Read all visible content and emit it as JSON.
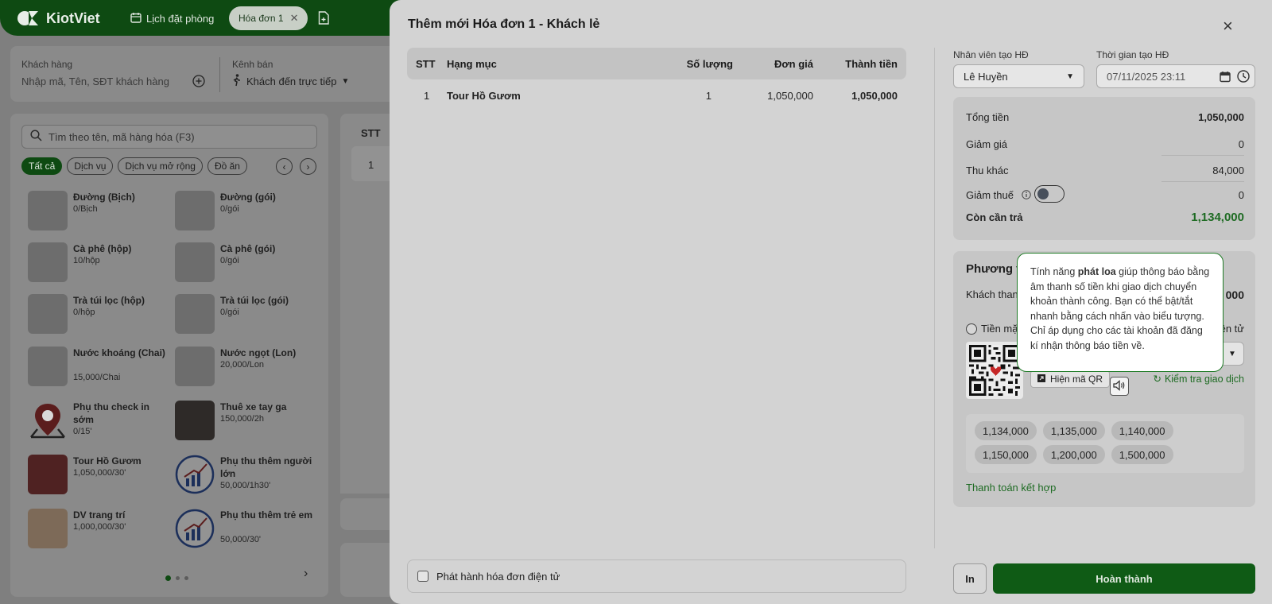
{
  "app": {
    "logo": "KiotViet",
    "nav_booking": "Lịch đặt phòng",
    "tab_active": "Hóa đơn 1"
  },
  "customer_bar": {
    "customer_label": "Khách hàng",
    "customer_placeholder": "Nhập mã, Tên, SĐT khách hàng",
    "channel_label": "Kênh bán",
    "channel_value": "Khách đến trực tiếp"
  },
  "products": {
    "search_placeholder": "Tìm theo tên, mã hàng hóa (F3)",
    "filters": [
      "Tất cả",
      "Dịch vụ",
      "Dịch vụ mở rộng",
      "Đồ ăn"
    ],
    "items": [
      {
        "name": "Đường (Bịch)",
        "price": "0/Bịch"
      },
      {
        "name": "Đường (gói)",
        "price": "0/gói"
      },
      {
        "name": "Cà phê (hộp)",
        "price": "10/hộp"
      },
      {
        "name": "Cà phê (gói)",
        "price": "0/gói"
      },
      {
        "name": "Trà túi lọc (hộp)",
        "price": "0/hộp"
      },
      {
        "name": "Trà túi lọc (gói)",
        "price": "0/gói"
      },
      {
        "name": "Nước khoáng (Chai)",
        "price": "15,000/Chai"
      },
      {
        "name": "Nước ngọt (Lon)",
        "price": "20,000/Lon"
      },
      {
        "name": "Phụ thu check in sớm",
        "price": "0/15'"
      },
      {
        "name": "Thuê xe tay ga",
        "price": "150,000/2h"
      },
      {
        "name": "Tour Hồ Gươm",
        "price": "1,050,000/30'"
      },
      {
        "name": "Phụ thu thêm người lớn",
        "price": "50,000/1h30'"
      },
      {
        "name": "DV trang trí",
        "price": "1,000,000/30'"
      },
      {
        "name": "Phụ thu thêm trẻ em",
        "price": "50,000/30'"
      }
    ]
  },
  "middle_bg": {
    "stt_header": "STT",
    "row_stt": "1"
  },
  "modal": {
    "title": "Thêm mới Hóa đơn 1 - Khách lẻ",
    "table": {
      "headers": {
        "stt": "STT",
        "item": "Hạng mục",
        "qty": "Số lượng",
        "price": "Đơn giá",
        "total": "Thành tiền"
      },
      "rows": [
        {
          "stt": "1",
          "item": "Tour Hồ Gươm",
          "qty": "1",
          "price": "1,050,000",
          "total": "1,050,000"
        }
      ]
    },
    "einvoice_label": "Phát hành hóa đơn điện tử",
    "staff_label": "Nhân viên tạo HĐ",
    "staff_value": "Lê Huyền",
    "time_label": "Thời gian tạo HĐ",
    "time_value": "07/11/2025 23:11",
    "summary": {
      "total_label": "Tổng tiền",
      "total_value": "1,050,000",
      "discount_label": "Giảm giá",
      "discount_value": "0",
      "other_label": "Thu khác",
      "other_value": "84,000",
      "tax_label": "Giảm thuế",
      "tax_value": "0",
      "due_label": "Còn cần trả",
      "due_value": "1,134,000"
    },
    "payment": {
      "title_partial": "Phương t",
      "customer_pay_partial": "Khách thanh",
      "customer_pay_value_partial": "000",
      "cash_partial": "Tiền mặ",
      "ewallet_partial": "iện tử",
      "show_qr_label": "Hiện mã QR",
      "check_tx_label": "Kiểm tra giao dịch",
      "quick_amounts": [
        "1,134,000",
        "1,135,000",
        "1,140,000",
        "1,150,000",
        "1,200,000",
        "1,500,000"
      ],
      "combined_label": "Thanh toán kết hợp"
    },
    "tooltip": {
      "prefix": "Tính năng ",
      "bold": "phát loa",
      "rest": " giúp thông báo bằng âm thanh số tiền khi giao dịch chuyển khoản thành công. Bạn có thể bật/tắt nhanh bằng cách nhấn vào biểu tượng. Chỉ áp dụng cho các tài khoản đã đăng kí nhận thông báo tiền về."
    },
    "print_label": "In",
    "done_label": "Hoàn thành"
  },
  "colors": {
    "brand_green": "#0f5b15",
    "accent_green": "#1e7a25"
  }
}
